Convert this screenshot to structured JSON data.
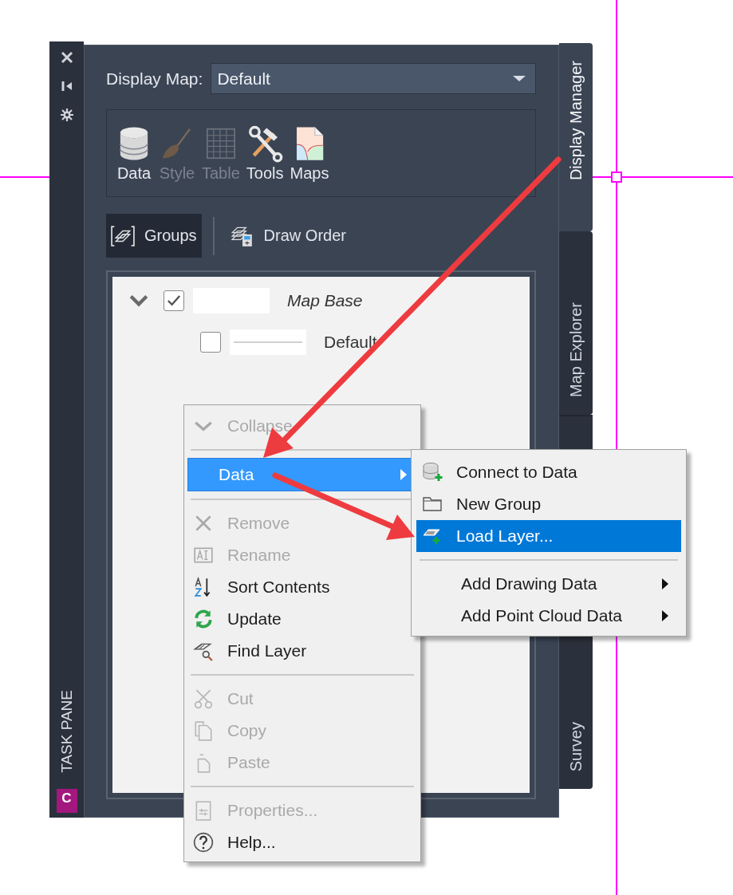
{
  "task_pane": {
    "title": "TASK PANE",
    "logo": "C"
  },
  "display_map": {
    "label": "Display Map:",
    "value": "Default"
  },
  "toolbar": [
    {
      "label": "Data",
      "disabled": false
    },
    {
      "label": "Style",
      "disabled": true
    },
    {
      "label": "Table",
      "disabled": true
    },
    {
      "label": "Tools",
      "disabled": false
    },
    {
      "label": "Maps",
      "disabled": false
    }
  ],
  "view_tabs": [
    {
      "label": "Groups",
      "selected": true
    },
    {
      "label": "Draw Order",
      "selected": false
    }
  ],
  "tree": [
    {
      "label": "Map Base",
      "checked": true,
      "expanded": true,
      "children": [
        {
          "label": "Default",
          "checked": false
        }
      ]
    }
  ],
  "side_tabs": [
    {
      "label": "Display Manager",
      "selected": true
    },
    {
      "label": "Map Explorer",
      "selected": false
    },
    {
      "label": "Survey",
      "selected": false
    }
  ],
  "context_menu": {
    "items": [
      {
        "kind": "item",
        "label": "Collapse",
        "disabled": true,
        "selected": false,
        "submenu": false
      },
      {
        "kind": "separator"
      },
      {
        "kind": "item",
        "label": "Data",
        "disabled": false,
        "selected": true,
        "submenu": true
      },
      {
        "kind": "separator"
      },
      {
        "kind": "item",
        "label": "Remove",
        "disabled": true,
        "selected": false,
        "submenu": false
      },
      {
        "kind": "item",
        "label": "Rename",
        "disabled": true,
        "selected": false,
        "submenu": false
      },
      {
        "kind": "item",
        "label": "Sort Contents",
        "disabled": false,
        "selected": false,
        "submenu": false
      },
      {
        "kind": "item",
        "label": "Update",
        "disabled": false,
        "selected": false,
        "submenu": false
      },
      {
        "kind": "item",
        "label": "Find Layer",
        "disabled": false,
        "selected": false,
        "submenu": false
      },
      {
        "kind": "separator"
      },
      {
        "kind": "item",
        "label": "Cut",
        "disabled": true,
        "selected": false,
        "submenu": false
      },
      {
        "kind": "item",
        "label": "Copy",
        "disabled": true,
        "selected": false,
        "submenu": false
      },
      {
        "kind": "item",
        "label": "Paste",
        "disabled": true,
        "selected": false,
        "submenu": false
      },
      {
        "kind": "separator"
      },
      {
        "kind": "item",
        "label": "Properties...",
        "disabled": true,
        "selected": false,
        "submenu": false
      },
      {
        "kind": "item",
        "label": "Help...",
        "disabled": false,
        "selected": false,
        "submenu": false
      }
    ]
  },
  "submenu": {
    "items": [
      {
        "kind": "item",
        "label": "Connect to Data",
        "selected": false,
        "submenu": false
      },
      {
        "kind": "item",
        "label": "New Group",
        "selected": false,
        "submenu": false
      },
      {
        "kind": "item",
        "label": "Load Layer...",
        "selected": true,
        "submenu": false
      },
      {
        "kind": "separator"
      },
      {
        "kind": "item",
        "label": "Add Drawing Data",
        "selected": false,
        "submenu": true
      },
      {
        "kind": "item",
        "label": "Add Point Cloud Data",
        "selected": false,
        "submenu": true
      }
    ]
  }
}
